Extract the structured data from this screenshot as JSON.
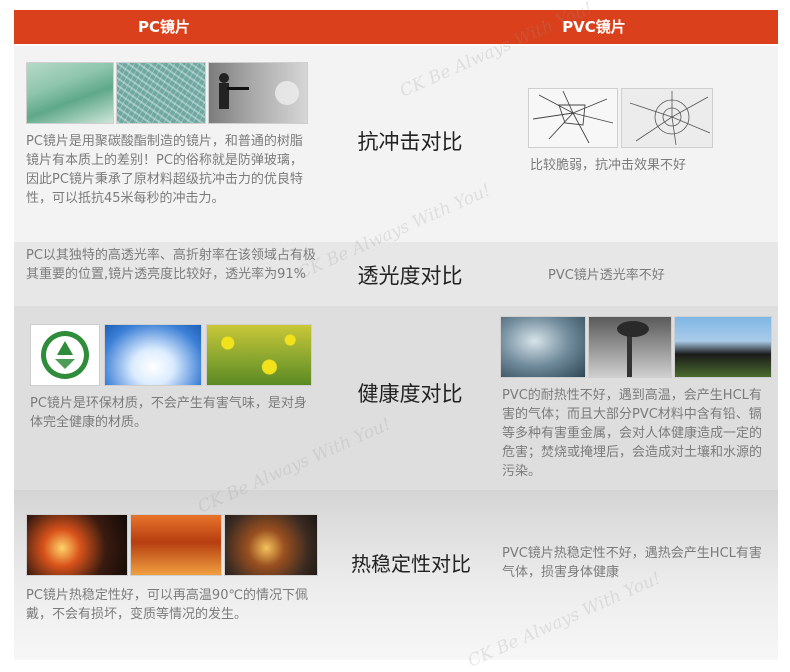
{
  "header": {
    "left": "PC镜片",
    "right": "PVC镜片"
  },
  "rows": [
    {
      "title": "抗冲击对比",
      "pc_text": "PC镜片是用聚碳酸酯制造的镜片，和普通的树脂镜片有本质上的差别！PC的俗称就是防弹玻璃，因此PC镜片秉承了原材料超级抗冲击力的优良特性，可以抵抗45米每秒的冲击力。",
      "pvc_text": "比较脆弱，抗冲击效果不好"
    },
    {
      "title": "透光度对比",
      "pc_text": "PC以其独特的高透光率、高折射率在该领域占有极其重要的位置,镜片透亮度比较好，透光率为91%",
      "pvc_text": "PVC镜片透光率不好"
    },
    {
      "title": "健康度对比",
      "pc_text": "PC镜片是环保材质，不会产生有害气味，是对身体完全健康的材质。",
      "pvc_text": "PVC的耐热性不好，遇到高温，会产生HCL有害的气体；而且大部分PVC材料中含有铅、镉等多种有害重金属，会对人体健康造成一定的危害；焚烧或掩埋后，会造成对土壤和水源的污染。"
    },
    {
      "title": "热稳定性对比",
      "pc_text": "PC镜片热稳定性好，可以再高温90℃的情况下佩戴，不会有损坏，变质等情况的发生。",
      "pvc_text": "PVC镜片热稳定性不好，遇热会产生HCL有害气体，损害身体健康"
    }
  ],
  "watermark": "CK Be Always With You!",
  "colors": {
    "header_bg": "#d9401b",
    "header_text": "#ffffff",
    "body_text": "#7b7b7b",
    "title_text": "#222222"
  }
}
